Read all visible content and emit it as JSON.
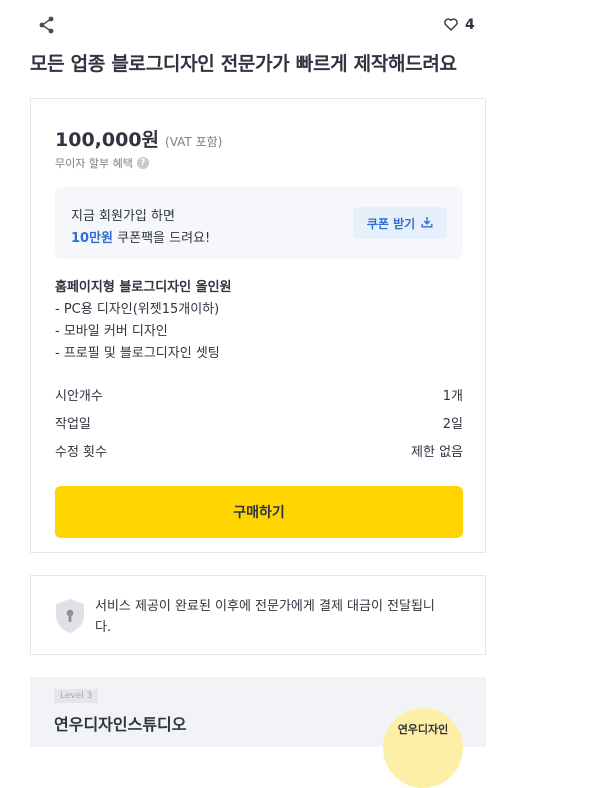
{
  "header": {
    "share_icon": "share-icon",
    "like_icon": "heart-icon",
    "like_count": "4"
  },
  "title": "모든 업종 블로그디자인 전문가가 빠르게 제작해드려요",
  "pricing": {
    "amount": "100,000원",
    "vat_note": "(VAT 포함)",
    "installment_label": "무이자 할부 혜택",
    "help_icon": "question-circle-icon"
  },
  "coupon": {
    "line1": "지금 회원가입 하면",
    "amount": "10만원",
    "line2_rest": " 쿠폰팩을 드려요!",
    "button_label": "쿠폰 받기",
    "button_icon": "download-icon"
  },
  "package": {
    "title": "홈페이지형 블로그디자인 올인원",
    "items": [
      "- PC용 디자인(위젯15개이하)",
      "- 모바일 커버 디자인",
      "- 프로필 및 블로그디자인 셋팅"
    ]
  },
  "specs": [
    {
      "label": "시안개수",
      "value": "1개"
    },
    {
      "label": "작업일",
      "value": "2일"
    },
    {
      "label": "수정 횟수",
      "value": "제한 없음"
    }
  ],
  "buy_button": "구매하기",
  "notice": {
    "icon": "shield-lock-icon",
    "text": "서비스 제공이 완료된 이후에 전문가에게 결제 대금이 전달됩니다."
  },
  "expert": {
    "level": "Level 3",
    "name": "연우디자인스튜디오",
    "avatar_text": "연우디자인"
  },
  "colors": {
    "accent": "#ffd400",
    "link": "#2f6ed6",
    "border": "#e4e5ed"
  }
}
